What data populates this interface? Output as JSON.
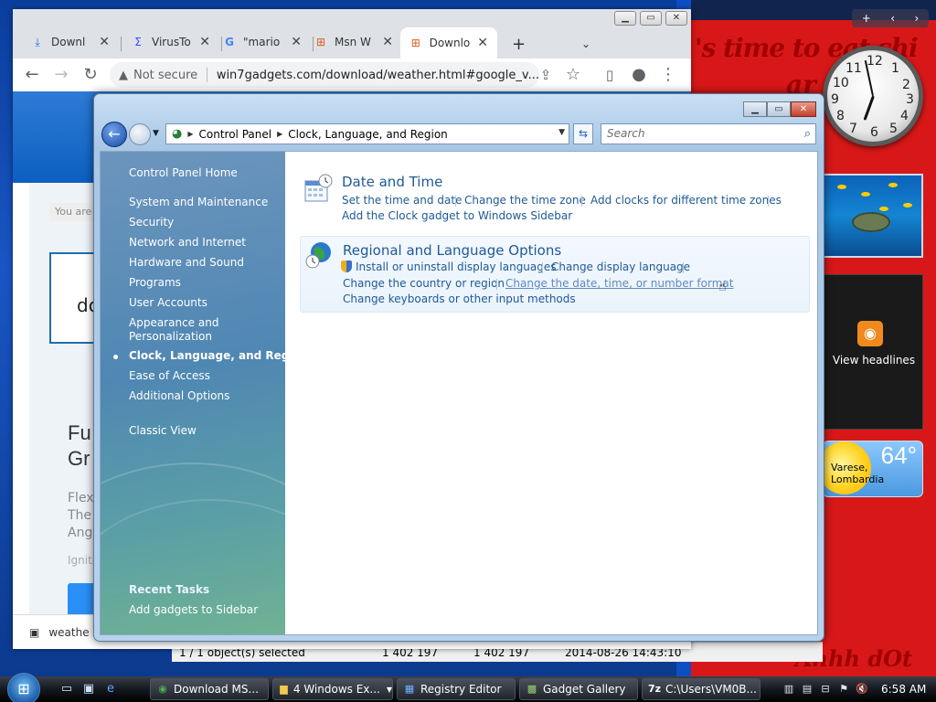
{
  "browser": {
    "tabs": [
      {
        "title": "Downl",
        "icon": "download-icon"
      },
      {
        "title": "VirusTo",
        "icon": "virustotal-icon"
      },
      {
        "title": "\"mario",
        "icon": "google-icon"
      },
      {
        "title": "Msn W",
        "icon": "windows-logo-icon"
      },
      {
        "title": "Downlo",
        "icon": "windows-logo-icon",
        "active": true
      }
    ],
    "security_label": "Not secure",
    "url": "win7gadgets.com/download/weather.html#google_v...",
    "page": {
      "breadcrumb_stub": "You are",
      "download_stub": "do",
      "heading": [
        "Fu",
        "Gr"
      ],
      "paragraph": [
        "Flex",
        "The",
        "Ang"
      ],
      "ignite": "Igniti",
      "download_bar_file": "weathe"
    }
  },
  "desktop": {
    "banner_line1": "'s time to eat shi",
    "banner_line2": "ar",
    "bottom_text": "Ahhh dOt"
  },
  "sidebar_gadgets": {
    "controls": [
      "+",
      "‹",
      "›"
    ],
    "clock_numbers": [
      "12",
      "1",
      "2",
      "3",
      "4",
      "5",
      "6",
      "7",
      "8",
      "9",
      "10",
      "11"
    ],
    "feed_label": "View headlines",
    "weather": {
      "temp": "64°",
      "place": "Varese, Lombardia"
    }
  },
  "explorer_status": {
    "selection": "1 / 1 object(s) selected",
    "size1": "1 402 197",
    "size2": "1 402 197",
    "date": "2014-08-26 14:43:10"
  },
  "control_panel": {
    "breadcrumb": [
      "Control Panel",
      "Clock, Language, and Region"
    ],
    "search_placeholder": "Search",
    "left_nav": {
      "home": "Control Panel Home",
      "items": [
        "System and Maintenance",
        "Security",
        "Network and Internet",
        "Hardware and Sound",
        "Programs",
        "User Accounts",
        "Appearance and",
        "Personalization",
        "Clock, Language, and Region",
        "Ease of Access",
        "Additional Options"
      ],
      "classic_view": "Classic View",
      "recent_tasks_title": "Recent Tasks",
      "recent_tasks": [
        "Add gadgets to Sidebar"
      ]
    },
    "categories": [
      {
        "title": "Date and Time",
        "links": [
          "Set the time and date",
          "Change the time zone",
          "Add clocks for different time zones",
          "Add the Clock gadget to Windows Sidebar"
        ]
      },
      {
        "title": "Regional and Language Options",
        "links": [
          "Install or uninstall display languages",
          "Change display language",
          "Change the country or region",
          "Change the date, time, or number format",
          "Change keyboards or other input methods"
        ]
      }
    ]
  },
  "taskbar": {
    "tasks": [
      {
        "label": "Download MS...",
        "icon": "chrome-icon"
      },
      {
        "label": "4 Windows Ex...",
        "icon": "folder-icon"
      },
      {
        "label": "Registry Editor",
        "icon": "registry-icon"
      },
      {
        "label": "Gadget Gallery",
        "icon": "gadget-icon"
      },
      {
        "label": "C:\\Users\\VM0B...",
        "icon": "7zip-icon"
      }
    ],
    "clock": "6:58 AM"
  }
}
